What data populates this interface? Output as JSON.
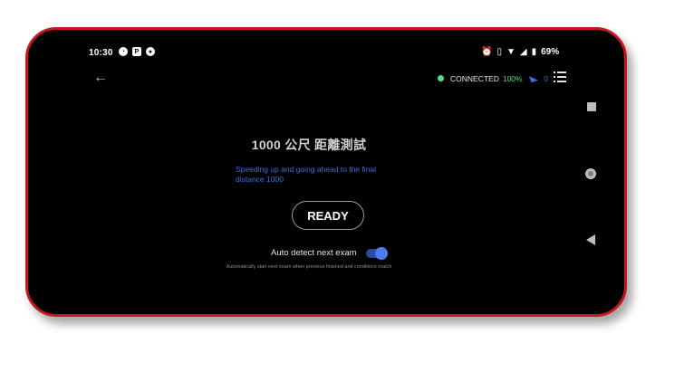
{
  "status_bar": {
    "time": "10:30",
    "notification_icons": [
      "chart-pie-icon",
      "p-square-icon",
      "panda-icon"
    ],
    "system_icons": [
      "alarm-icon",
      "vibrate-icon",
      "wifi-icon",
      "signal-icon",
      "battery-icon"
    ],
    "battery": "69%"
  },
  "header": {
    "back_icon": "arrow-left-icon",
    "connection": {
      "status": "CONNECTED",
      "percent": "100%",
      "status_color": "#52e07a",
      "satellite_icon": "satellite-icon",
      "satellite_count": "0",
      "accent_color": "#3c6fdf"
    },
    "menu_icon": "list-menu-icon"
  },
  "main": {
    "title": "1000 公尺 距離測試",
    "description_line1": "Speeding up and going ahead to the final",
    "description_line2": "distance 1000",
    "ready_button": "READY",
    "auto_detect_label": "Auto detect next exam",
    "auto_detect_enabled": true,
    "auto_detect_hint": "Automatically start next exam when previous finished and conditions match"
  },
  "nav_bar": {
    "icons": [
      "recents-square-icon",
      "home-circle-icon",
      "back-triangle-icon"
    ]
  }
}
